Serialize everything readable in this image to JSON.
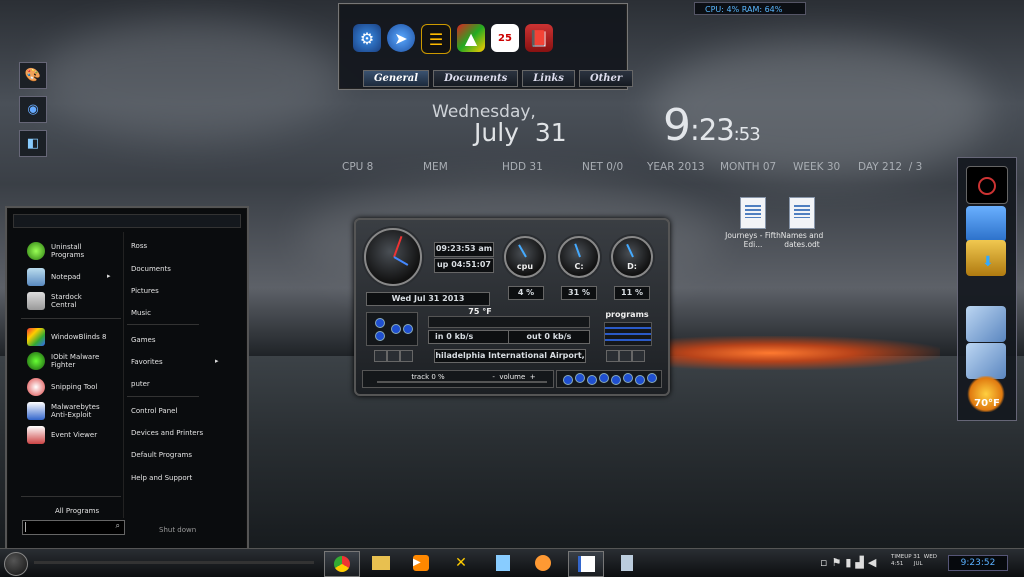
{
  "top_launcher": {
    "icons": [
      "settings-icon",
      "cursor-icon",
      "notes-icon",
      "apps-icon",
      "calendar-icon",
      "book-icon"
    ],
    "calendar_day": "25",
    "tabs": [
      "General",
      "Documents",
      "Links",
      "Other"
    ],
    "active_tab": "General"
  },
  "cpu_ram_meter": {
    "text": "CPU: 4%   RAM: 64%"
  },
  "left_quick_icons": [
    "paint-icon",
    "globe-icon",
    "cube-icon"
  ],
  "datetime": {
    "day_name": "Wednesday,",
    "month_day": "July  31",
    "clock_hour": "9",
    "clock_min": ":23",
    "clock_sec": ":53"
  },
  "stats": [
    "CPU 8",
    "MEM",
    "HDD 31",
    "NET 0/0",
    "YEAR 2013",
    "MONTH 07",
    "WEEK 30",
    "DAY 212  / 3"
  ],
  "desktop_files": [
    {
      "label": "Journeys - Fifth Edi..."
    },
    {
      "label": "Names and dates.odt"
    }
  ],
  "right_dock": {
    "icons": [
      "monitor-icon",
      "control-panel-icon",
      "folder-icon",
      "network-icon",
      "network-icon-2",
      "weather-icon"
    ],
    "temperature": "70°F"
  },
  "gauge_widget": {
    "time": "09:23:53 am",
    "uptime": "up 04:51:07",
    "gauges": [
      {
        "label": "cpu",
        "value": "4 %"
      },
      {
        "label": "C:",
        "value": "31 %"
      },
      {
        "label": "D:",
        "value": "11 %"
      }
    ],
    "date": "Wed  Jul  31  2013",
    "temperature": "75 °F",
    "net_in": "in  0 kb/s",
    "net_out": "out  0 kb/s",
    "location": "hiladelphia International Airport,",
    "programs_label": "programs",
    "track": "track 0 %",
    "volume": "-  volume  +"
  },
  "start_menu": {
    "left_items": [
      "Uninstall Programs",
      "Notepad",
      "Stardock Central",
      "WindowBlinds 8",
      "IObit Malware Fighter",
      "Snipping Tool",
      "Malwarebytes Anti-Exploit",
      "Event Viewer"
    ],
    "all_programs": "All Programs",
    "right_items": [
      "Ross",
      "Documents",
      "Pictures",
      "Music",
      "Games",
      "Favorites",
      "puter",
      "Control Panel",
      "Devices and Printers",
      "Default Programs",
      "Help and Support"
    ],
    "shutdown": "Shut down"
  },
  "taskbar": {
    "apps": [
      "chrome-icon",
      "explorer-icon",
      "media-player-icon",
      "tools-icon",
      "notepad-icon",
      "paint-icon",
      "writer-icon",
      "calculator-icon"
    ],
    "tray_date_line1": "TIMEUP 31  WED",
    "tray_date_line2": "4:51      JUL",
    "clock": "9:23:52"
  }
}
